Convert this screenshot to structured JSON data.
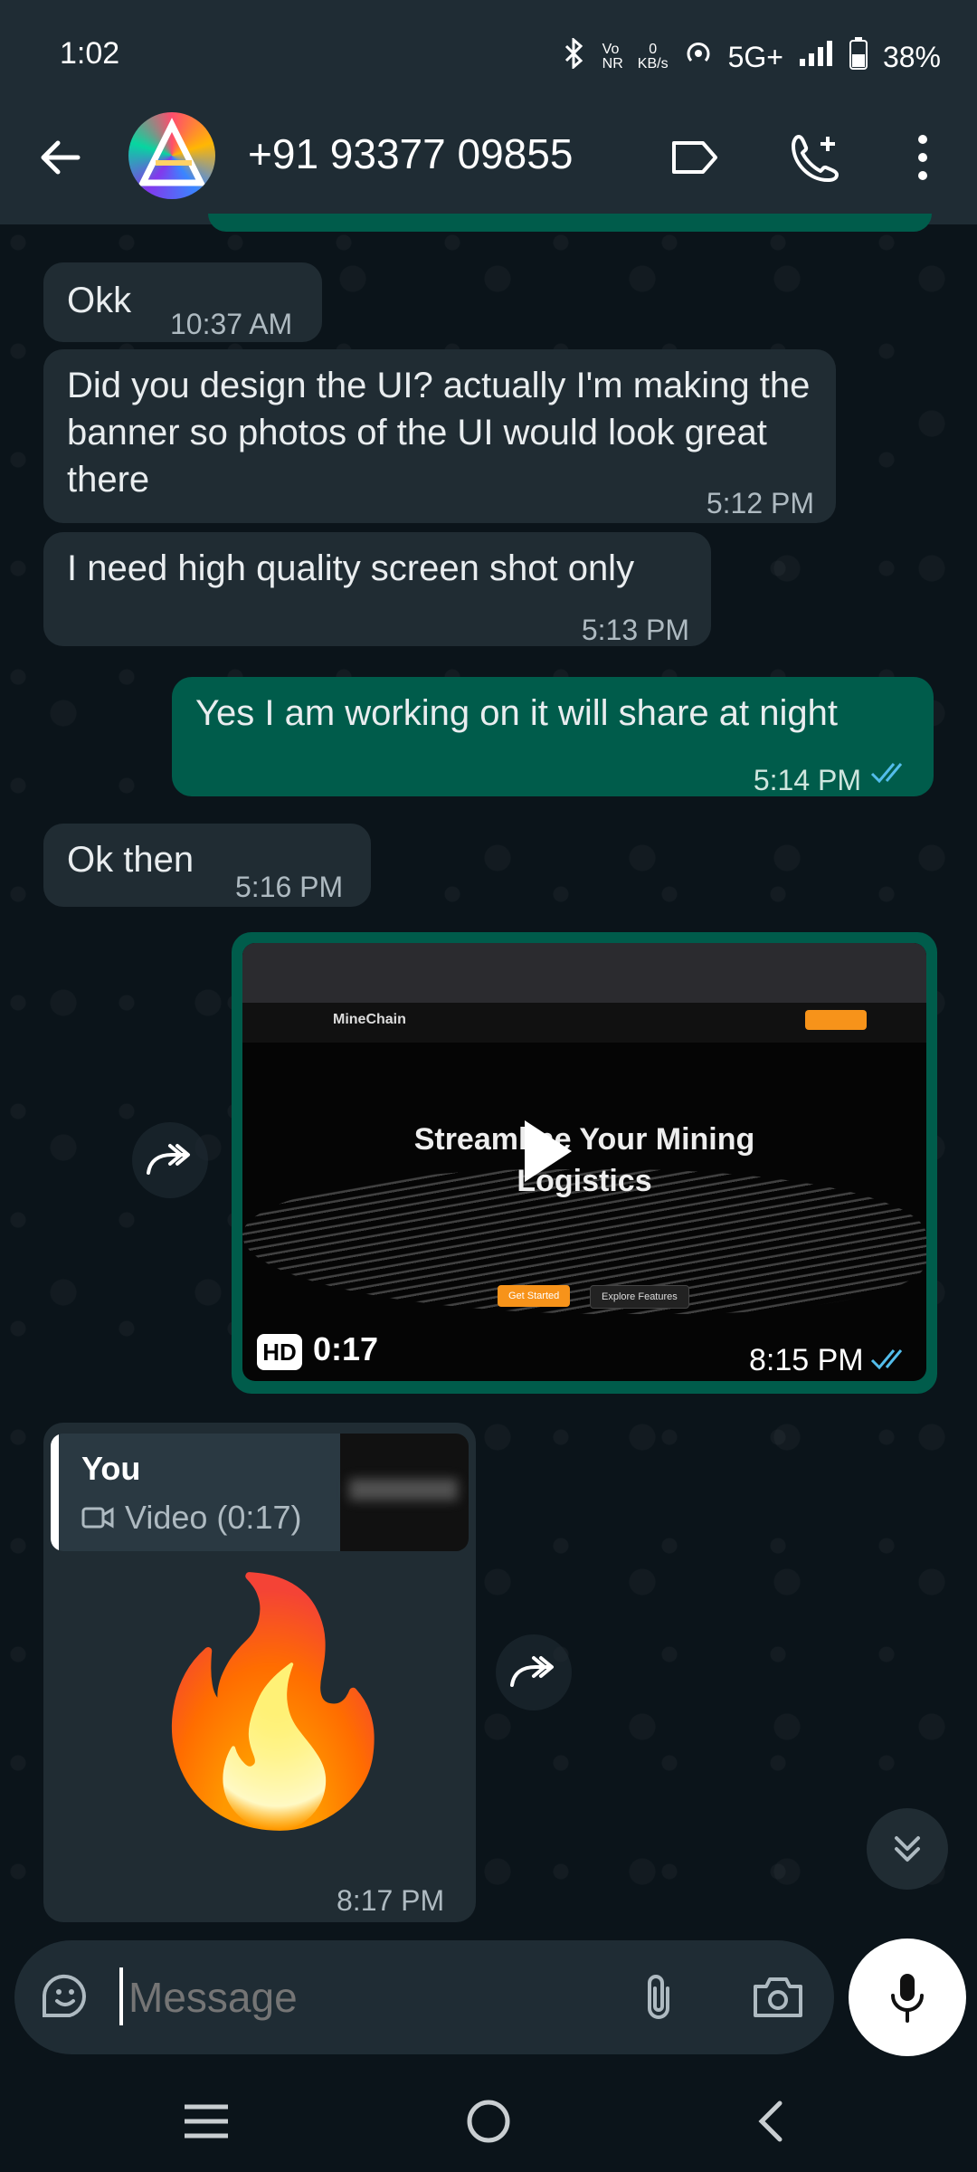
{
  "status_bar": {
    "time": "1:02",
    "network_speed_value": "0",
    "network_speed_unit": "KB/s",
    "volte": "Vo",
    "nr": "NR",
    "network_type": "5G+",
    "battery": "38%"
  },
  "header": {
    "contact_name": "+91 93377 09855",
    "icons": [
      "back-arrow-icon",
      "label-icon",
      "add-call-icon",
      "more-vert-icon"
    ]
  },
  "messages": [
    {
      "dir": "in",
      "text": "Okk",
      "time": "10:37 AM"
    },
    {
      "dir": "in",
      "text": "Did you design the UI? actually I'm making the banner so photos of the UI would look great there",
      "time": "5:12 PM"
    },
    {
      "dir": "in",
      "text": "I need high quality screen shot only",
      "time": "5:13 PM"
    },
    {
      "dir": "out",
      "text": "Yes I am working on it will share at night",
      "time": "5:14 PM"
    },
    {
      "dir": "in",
      "text": "Ok then",
      "time": "5:16 PM"
    }
  ],
  "video_message": {
    "site_name": "MineChain",
    "hero_line1": "Streamline Your Mining",
    "hero_line2": "Logistics",
    "badge": "HD",
    "duration": "0:17",
    "time": "8:15 PM",
    "cta_primary": "Get Started",
    "cta_secondary": "Explore Features"
  },
  "reply_message": {
    "quoted_author": "You",
    "quoted_type": "Video (0:17)",
    "emoji": "🔥",
    "time": "8:17 PM"
  },
  "composer": {
    "placeholder": "Message"
  },
  "colors": {
    "background": "#0b141a",
    "incoming_bubble": "#202c33",
    "outgoing_bubble": "#005c4b",
    "read_ticks": "#53bdeb"
  }
}
